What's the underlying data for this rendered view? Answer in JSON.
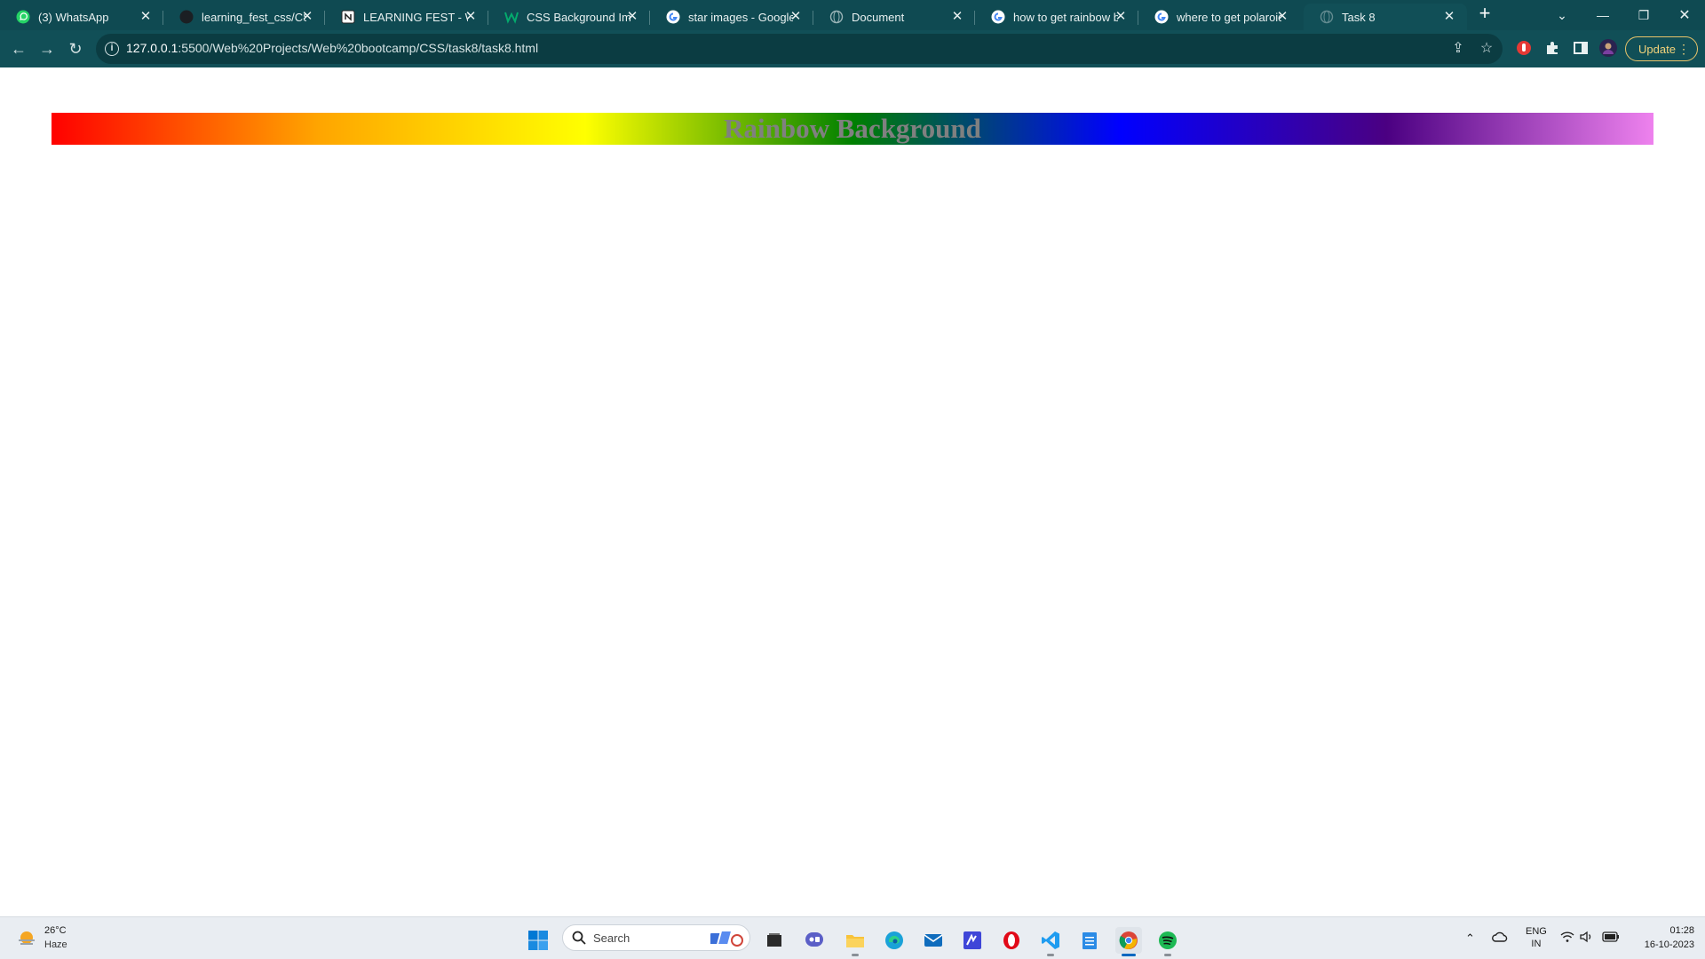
{
  "browser": {
    "tabs": [
      {
        "title": "(3) WhatsApp",
        "icon": "whatsapp-icon"
      },
      {
        "title": "learning_fest_css/CSS",
        "icon": "github-icon"
      },
      {
        "title": "LEARNING FEST - WE",
        "icon": "notion-icon"
      },
      {
        "title": "CSS Background Imag",
        "icon": "w3schools-icon"
      },
      {
        "title": "star images - Google",
        "icon": "google-icon"
      },
      {
        "title": "Document",
        "icon": "globe-icon"
      },
      {
        "title": "how to get rainbow b",
        "icon": "google-icon"
      },
      {
        "title": "where to get polaroid",
        "icon": "google-icon"
      },
      {
        "title": "Task 8",
        "icon": "globe-icon",
        "active": true
      }
    ],
    "address": {
      "host": "127.0.0.1",
      "path": ":5500/Web%20Projects/Web%20bootcamp/CSS/task8/task8.html"
    },
    "update_label": "Update"
  },
  "page": {
    "heading": "Rainbow Background",
    "gradient_colors": [
      "#ff0000",
      "#ffa500",
      "#ffff00",
      "#008000",
      "#0000ff",
      "#4b0082",
      "#ee82ee"
    ],
    "heading_color": "#808080"
  },
  "taskbar": {
    "weather": {
      "temp": "26°C",
      "condition": "Haze"
    },
    "search_placeholder": "Search",
    "language": {
      "line1": "ENG",
      "line2": "IN"
    },
    "clock": {
      "time": "01:28",
      "date": "16-10-2023"
    }
  }
}
